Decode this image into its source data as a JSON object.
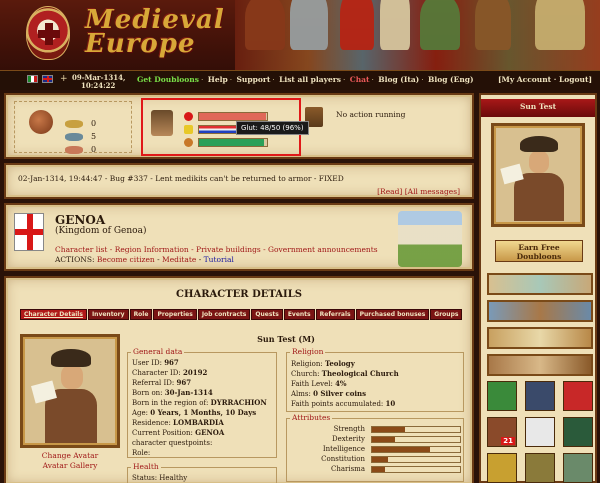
{
  "header": {
    "logo_title": "Medieval Europe",
    "date": "09-Mar-1314,",
    "time": "10:24:22",
    "nav": [
      "Get Doubloons",
      "Help",
      "Support",
      "List all players",
      "Chat",
      "Blog (Ita)",
      "Blog (Eng)"
    ],
    "account": [
      "My Account",
      "Logout"
    ],
    "colors": {
      "nav_green": "#7ae048",
      "nav_red": "#e85858"
    }
  },
  "status": {
    "resources": [
      {
        "icon": "coin-icon",
        "value": "0"
      },
      {
        "icon": "silver-icon",
        "value": "5"
      },
      {
        "icon": "copper-icon",
        "value": "0"
      }
    ],
    "bars": {
      "health": 0.98,
      "energy": 0.96,
      "food": 0.96
    },
    "tooltip": "Glut: 48/50 (96%)",
    "action_text": "No action running"
  },
  "news": {
    "text": "02-Jan-1314, 19:44:47 - Bug #337 - Lent medikits can't be returned to armor - FIXED",
    "links": [
      "[Read]",
      "[All messages]"
    ]
  },
  "city": {
    "name": "GENOA",
    "kingdom": "(Kingdom of Genoa)",
    "links": [
      "Character list",
      "Region Information",
      "Private buildings",
      "Government announcements"
    ],
    "actions_label": "ACTIONS:",
    "actions": [
      "Become citizen",
      "Meditate",
      "Tutorial"
    ]
  },
  "details": {
    "title": "CHARACTER DETAILS",
    "tabs": [
      "Character Details",
      "Inventory",
      "Role",
      "Properties",
      "Job contracts",
      "Quests",
      "Events",
      "Referrals",
      "Purchased bonuses",
      "Groups"
    ],
    "char_name": "Sun Test (M)",
    "change_avatar": "Change Avatar",
    "avatar_gallery": "Avatar Gallery",
    "general": {
      "legend": "General data",
      "rows": [
        {
          "label": "User ID:",
          "value": "967"
        },
        {
          "label": "Character ID:",
          "value": "20192"
        },
        {
          "label": "Referral ID:",
          "value": "967"
        },
        {
          "label": "Born on:",
          "value": "30-Jan-1314"
        },
        {
          "label": "Born in the region of:",
          "value": "DYRRACHION"
        },
        {
          "label": "Age:",
          "value": "0 Years, 1 Months, 10 Days"
        },
        {
          "label": "Residence:",
          "value": "LOMBARDIA"
        },
        {
          "label": "Current Position:",
          "value": "GENOA"
        },
        {
          "label": "character questpoints:",
          "value": ""
        },
        {
          "label": "Role:",
          "value": ""
        }
      ]
    },
    "health": {
      "legend": "Health",
      "status_label": "Status:",
      "status_value": "Healthy"
    },
    "religion": {
      "legend": "Religion",
      "rows": [
        {
          "label": "Religion:",
          "value": "Teology"
        },
        {
          "label": "Church:",
          "value": "Theological Church"
        },
        {
          "label": "Faith Level:",
          "value": "4%"
        },
        {
          "label": "Alms:",
          "value": "0 Silver coins"
        },
        {
          "label": "Faith points accumulated:",
          "value": "10"
        }
      ]
    },
    "attributes": {
      "legend": "Attributes",
      "items": [
        {
          "name": "Strength",
          "level": 0.38
        },
        {
          "name": "Dexterity",
          "level": 0.26
        },
        {
          "name": "Intelligence",
          "level": 0.66
        },
        {
          "name": "Constitution",
          "level": 0.18
        },
        {
          "name": "Charisma",
          "level": 0.15
        }
      ]
    }
  },
  "sidebar": {
    "user": "Sun Test",
    "earn_line1": "Earn Free",
    "earn_line2": "Doubloons",
    "badge_count": "21"
  }
}
